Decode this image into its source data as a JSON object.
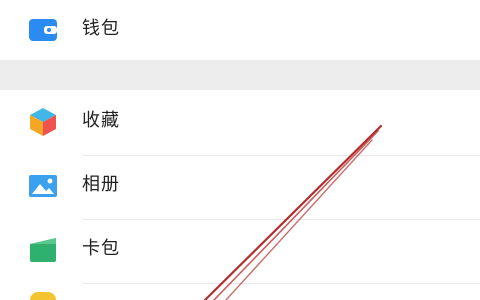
{
  "menu": {
    "items": [
      {
        "label": "钱包",
        "icon": "wallet-icon",
        "color": "#2a8bf2"
      },
      {
        "label": "收藏",
        "icon": "cube-icon",
        "color": "#f5a623"
      },
      {
        "label": "相册",
        "icon": "photo-icon",
        "color": "#3ba0ee"
      },
      {
        "label": "卡包",
        "icon": "card-icon",
        "color": "#2fb06e"
      }
    ]
  },
  "annotation": {
    "color": "#b03030"
  }
}
